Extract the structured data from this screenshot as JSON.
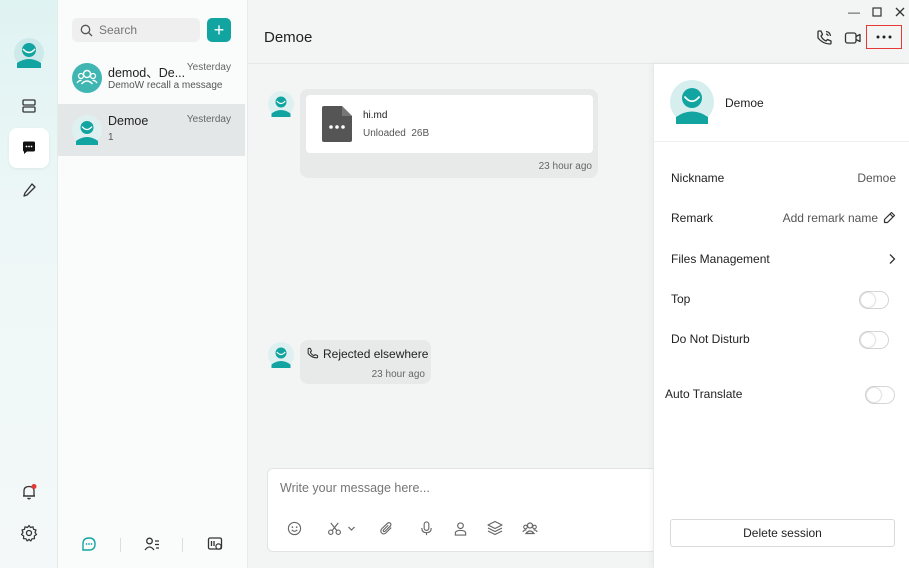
{
  "app": {
    "colors": {
      "accent": "#12a4a1",
      "highlight": "#e53935"
    }
  },
  "search": {
    "placeholder": "Search"
  },
  "conversations": [
    {
      "name": "demod、De...",
      "time": "Yesterday",
      "preview": "DemoW recall a message",
      "icon": "group-avatar-icon"
    },
    {
      "name": "Demoe",
      "time": "Yesterday",
      "preview": "1",
      "icon": "user-avatar-icon"
    }
  ],
  "chat": {
    "title": "Demoe",
    "messages": [
      {
        "type": "file",
        "file_name": "hi.md",
        "file_status": "Unloaded",
        "file_size": "26B",
        "time": "23 hour ago"
      },
      {
        "type": "call",
        "text": "Rejected elsewhere",
        "time": "23 hour ago"
      }
    ],
    "composer": {
      "placeholder": "Write your message here..."
    }
  },
  "panel": {
    "name": "Demoe",
    "nickname_label": "Nickname",
    "nickname_value": "Demoe",
    "remark_label": "Remark",
    "remark_value": "Add remark name",
    "files_label": "Files Management",
    "top_label": "Top",
    "top_on": false,
    "dnd_label": "Do Not Disturb",
    "dnd_on": false,
    "translate_label": "Auto Translate",
    "translate_on": false,
    "delete_label": "Delete session"
  }
}
